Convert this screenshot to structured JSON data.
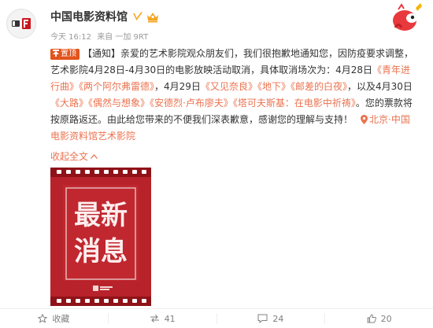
{
  "header": {
    "account_name": "中国电影资料馆",
    "time": "今天 16:12",
    "source": "来自 一加 9RT",
    "avatar_icon": "cfa-logo-icon",
    "verified_color": "#f5a623"
  },
  "post": {
    "top_badge": "置顶",
    "notice_tag": "【通知】",
    "body_main": "亲爱的艺术影院观众朋友们，我们很抱歉地通知您，因防疫要求调整，艺术影院4月28日-4月30日的电影放映活动取消，具体取消场次为：4月28日",
    "film_1": "《青年进行曲》",
    "film_2": "《两个阿尔弗雷德》",
    "sep_1": "，4月29日",
    "film_3": "《又见奈良》",
    "film_4": "《地下》",
    "film_5": "《邮差的白夜》",
    "sep_2": "，以及4月30日",
    "film_6": "《大路》",
    "film_7": "《偶然与想象》",
    "film_8": "《安德烈·卢布廖夫》",
    "film_9": "《塔可夫斯基：在电影中祈祷》",
    "body_end": "。您的票款将按原路返还。由此给您带来的不便我们深表歉意，感谢您的理解与支持！",
    "location": "北京·中国电影资料馆艺术影院",
    "collapse_label": "收起全文"
  },
  "poster": {
    "line_1": "最新",
    "line_2": "消息",
    "brand_color": "#b8222a"
  },
  "actions": {
    "favorite_label": "收藏",
    "repost_count": "41",
    "comment_count": "24",
    "like_count": "20"
  }
}
